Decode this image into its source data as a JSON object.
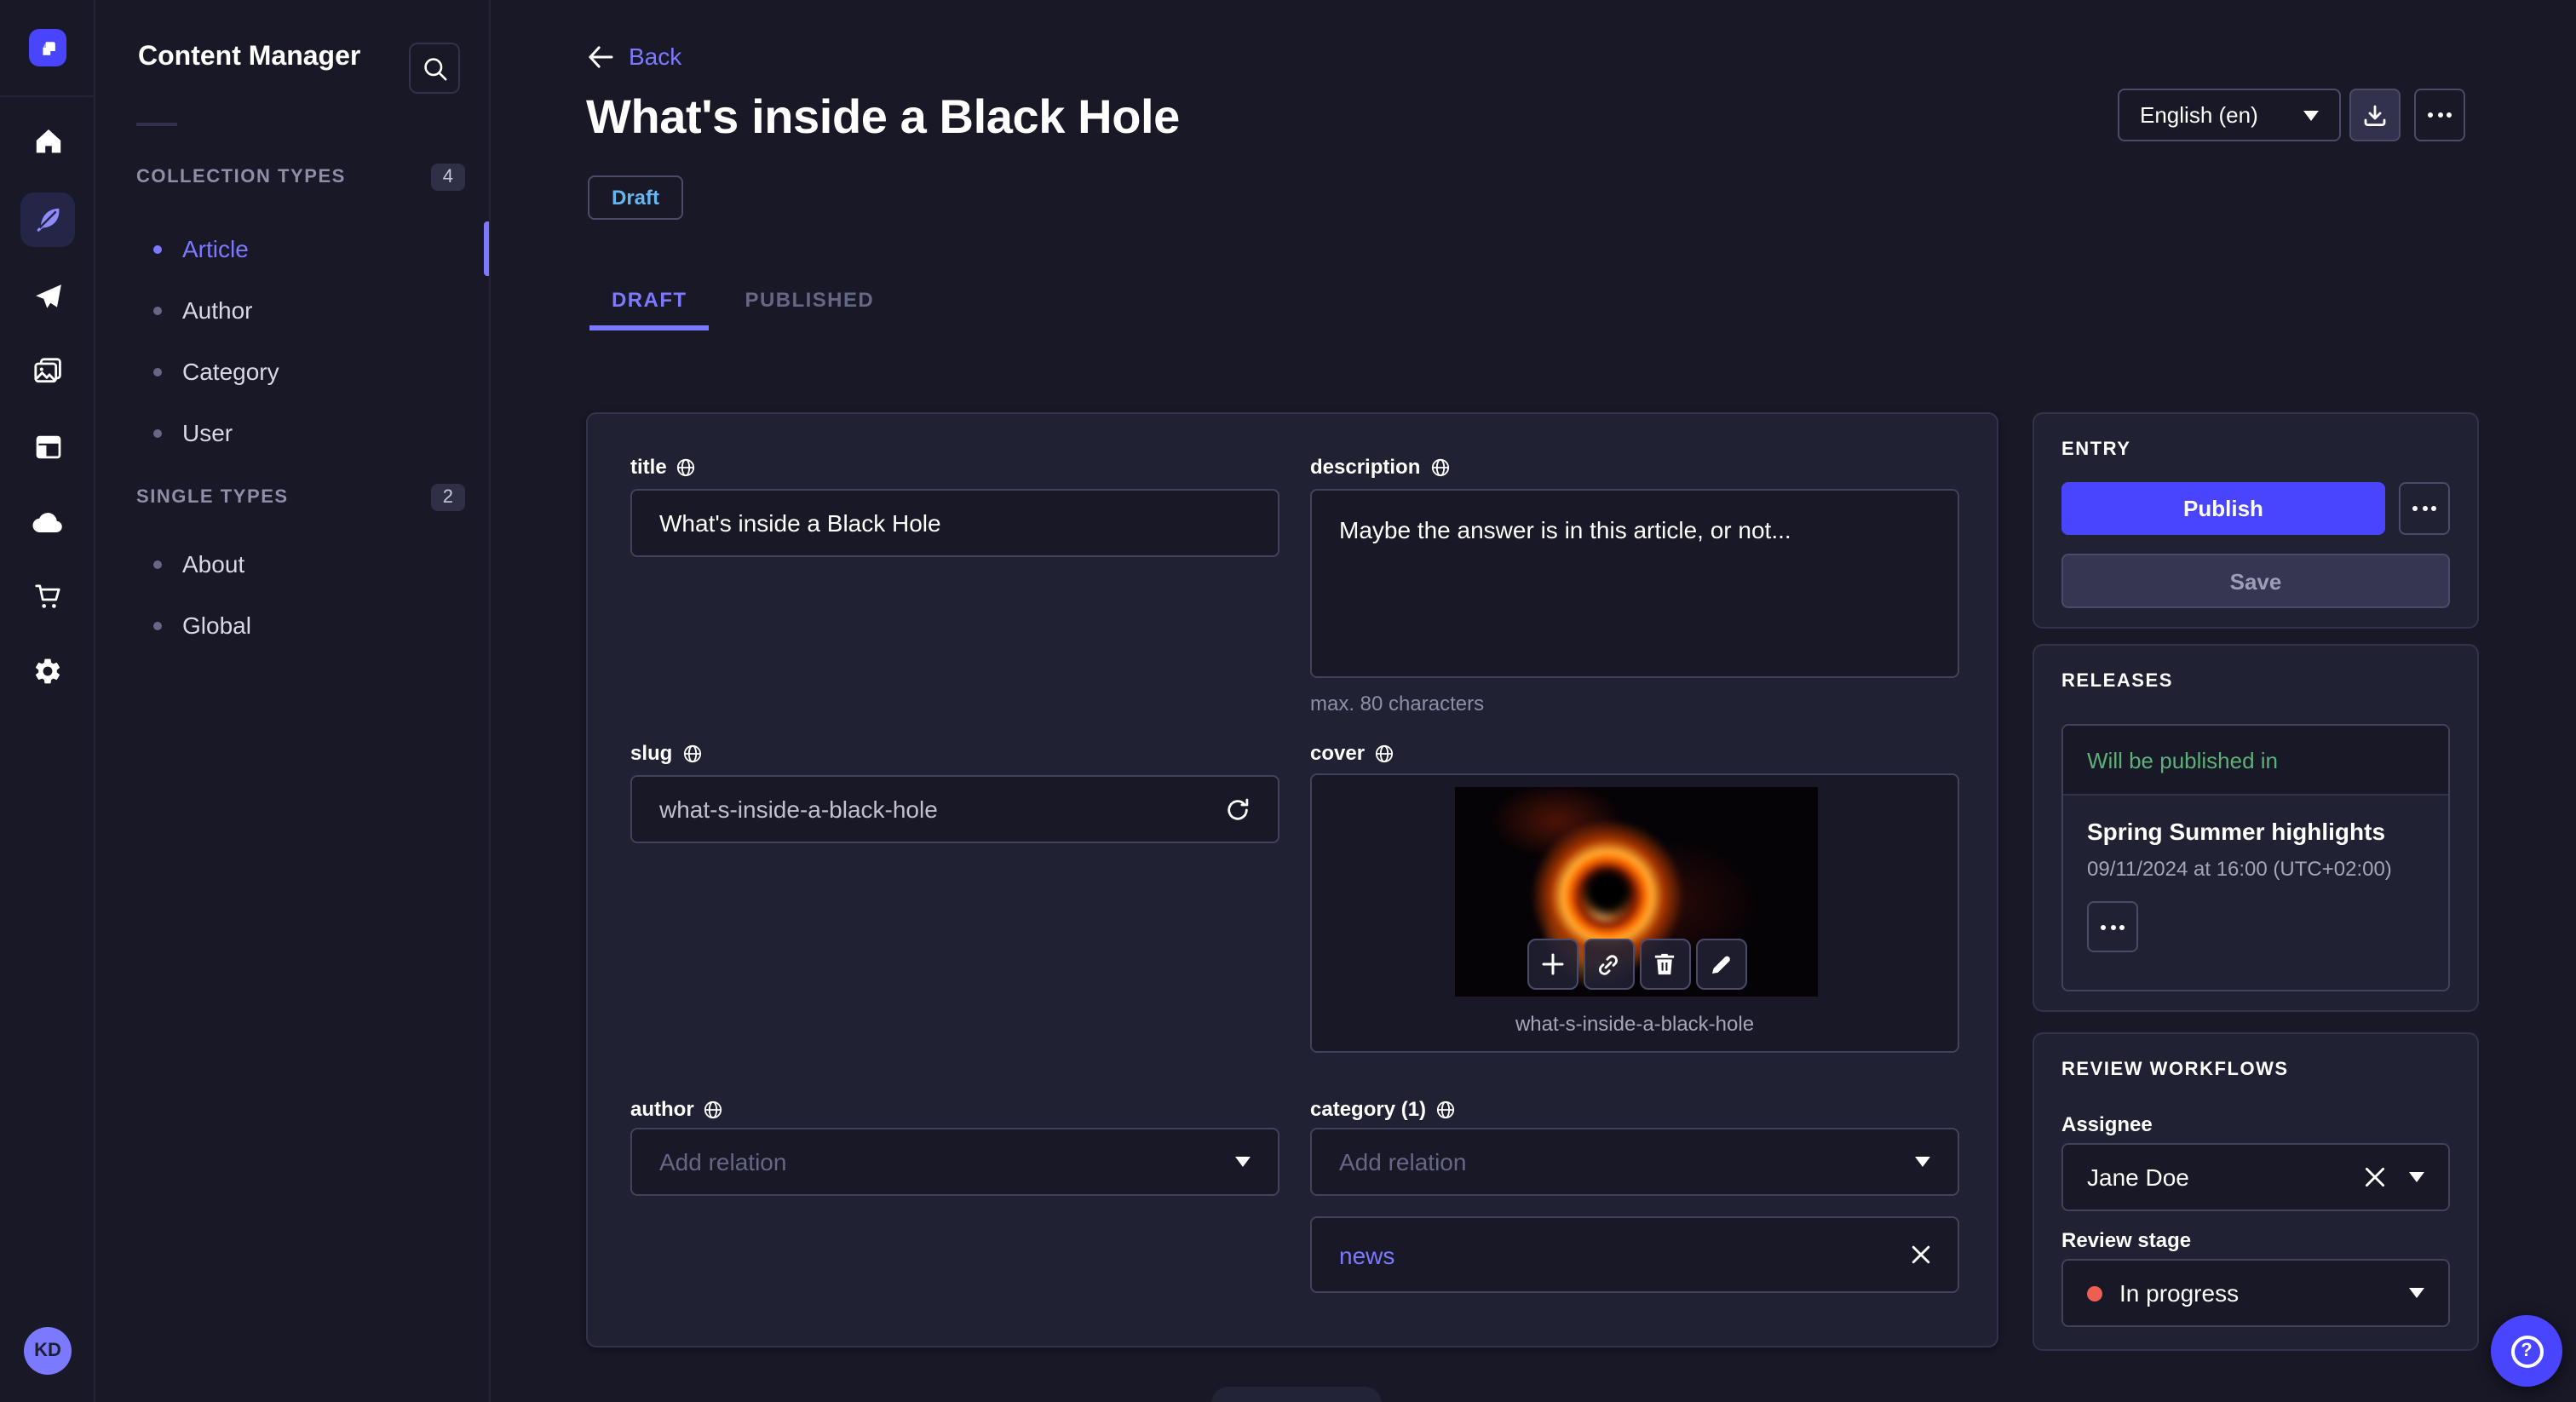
{
  "colors": {
    "accent": "#4945ff",
    "accent_light": "#7b79ff",
    "draft_badge": "#66b7f1",
    "success": "#5cb176",
    "danger": "#ee5e52",
    "surface": "#212134",
    "background": "#181826"
  },
  "rail": {
    "avatar_initials": "KD",
    "icons": [
      "strapi-logo-icon",
      "home-icon",
      "content-manager-icon",
      "releases-icon",
      "media-library-icon",
      "content-type-builder-icon",
      "deploy-icon",
      "marketplace-icon",
      "settings-icon"
    ]
  },
  "subnav": {
    "title": "Content Manager",
    "sections": [
      {
        "label": "COLLECTION TYPES",
        "badge": "4",
        "items": [
          {
            "label": "Article",
            "active": true
          },
          {
            "label": "Author"
          },
          {
            "label": "Category"
          },
          {
            "label": "User"
          }
        ]
      },
      {
        "label": "SINGLE TYPES",
        "badge": "2",
        "items": [
          {
            "label": "About"
          },
          {
            "label": "Global"
          }
        ]
      }
    ]
  },
  "header": {
    "back": "Back",
    "title": "What's inside a Black Hole",
    "status": "Draft",
    "locale": "English (en)"
  },
  "tabs": [
    {
      "label": "DRAFT",
      "active": true
    },
    {
      "label": "PUBLISHED",
      "active": false
    }
  ],
  "form": {
    "title": {
      "label": "title",
      "value": "What's inside a Black Hole"
    },
    "description": {
      "label": "description",
      "value": "Maybe the answer is in this article, or not...",
      "helper": "max. 80 characters"
    },
    "slug": {
      "label": "slug",
      "value": "what-s-inside-a-black-hole"
    },
    "cover": {
      "label": "cover",
      "filename": "what-s-inside-a-black-hole"
    },
    "author": {
      "label": "author",
      "placeholder": "Add relation"
    },
    "category": {
      "label": "category (1)",
      "placeholder": "Add relation",
      "tag": "news"
    }
  },
  "entry": {
    "title": "ENTRY",
    "publish": "Publish",
    "save": "Save"
  },
  "releases": {
    "title": "RELEASES",
    "status": "Will be published in",
    "name": "Spring Summer highlights",
    "date": "09/11/2024 at 16:00 (UTC+02:00)"
  },
  "review": {
    "title": "REVIEW WORKFLOWS",
    "assignee_label": "Assignee",
    "assignee": "Jane Doe",
    "stage_label": "Review stage",
    "stage": "In progress"
  }
}
